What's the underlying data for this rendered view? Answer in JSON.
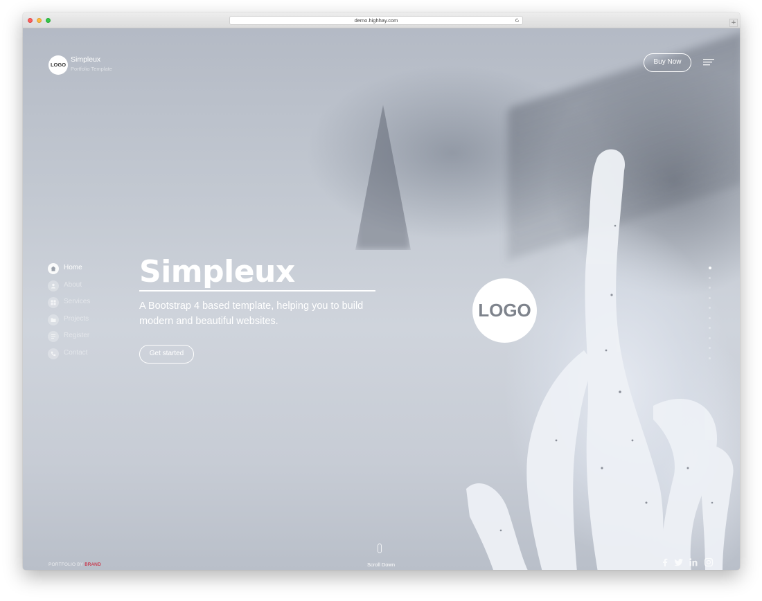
{
  "browser": {
    "url": "demo.highhay.com",
    "new_tab_glyph": "+"
  },
  "header": {
    "logo_text": "LOGO",
    "brand_name": "Simpleux",
    "tagline": "Portfolio Template",
    "buy_label": "Buy Now",
    "menu_icon": "hamburger-menu-icon"
  },
  "nav": {
    "items": [
      {
        "label": "Home",
        "icon": "home-icon",
        "active": true
      },
      {
        "label": "About",
        "icon": "user-icon",
        "active": false
      },
      {
        "label": "Services",
        "icon": "grid-icon",
        "active": false
      },
      {
        "label": "Projects",
        "icon": "folder-icon",
        "active": false
      },
      {
        "label": "Register",
        "icon": "form-icon",
        "active": false
      },
      {
        "label": "Contact",
        "icon": "phone-icon",
        "active": false
      }
    ]
  },
  "hero": {
    "title": "Simpleux",
    "subtitle": "A Bootstrap 4 based template, helping you to build modern and beautiful websites.",
    "cta_label": "Get started",
    "center_logo_text": "LOGO"
  },
  "pagination": {
    "active_index": 0,
    "count": 10
  },
  "footer": {
    "credit_prefix": "PORTFOLIO BY",
    "credit_brand": "BRAND",
    "scroll_label": "Scroll Down",
    "social": [
      "facebook-icon",
      "twitter-icon",
      "linkedin-icon",
      "instagram-icon"
    ]
  },
  "colors": {
    "accent_brand": "#d0021b",
    "text_on_image": "#ffffff"
  }
}
